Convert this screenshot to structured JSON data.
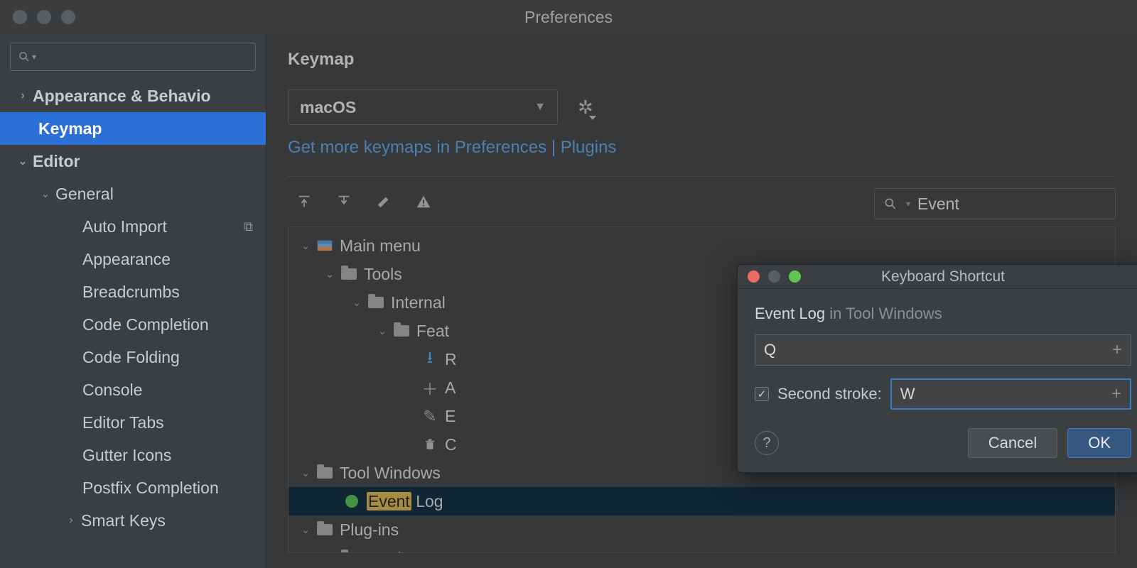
{
  "window": {
    "title": "Preferences"
  },
  "sidebar": {
    "items": [
      {
        "label": "Appearance & Behavio",
        "lvl": 0,
        "disc": "›"
      },
      {
        "label": "Keymap",
        "lvl": 1,
        "selected": true
      },
      {
        "label": "Editor",
        "lvl": 0,
        "disc": "⌄"
      },
      {
        "label": "General",
        "lvl": 1,
        "disc": "⌄"
      },
      {
        "label": "Auto Import",
        "lvl": 2,
        "trail_icon": true
      },
      {
        "label": "Appearance",
        "lvl": 2
      },
      {
        "label": "Breadcrumbs",
        "lvl": 2
      },
      {
        "label": "Code Completion",
        "lvl": 2
      },
      {
        "label": "Code Folding",
        "lvl": 2
      },
      {
        "label": "Console",
        "lvl": 2
      },
      {
        "label": "Editor Tabs",
        "lvl": 2
      },
      {
        "label": "Gutter Icons",
        "lvl": 2
      },
      {
        "label": "Postfix Completion",
        "lvl": 2
      },
      {
        "label": "Smart Keys",
        "lvl": 2,
        "disc": "›",
        "lvl2b": true
      }
    ]
  },
  "content": {
    "heading": "Keymap",
    "scheme": "macOS",
    "link": "Get more keymaps in Preferences | Plugins",
    "search_value": "Event",
    "tree": {
      "main_menu": "Main menu",
      "tools": "Tools",
      "internal": "Internal",
      "feat": "Feat",
      "r": "R",
      "a": "A",
      "e": "E",
      "c": "C",
      "tool_windows": "Tool Windows",
      "event": "Event",
      "log": " Log",
      "plugins": "Plug-ins",
      "spy": "Spy-is"
    }
  },
  "modal": {
    "title": "Keyboard Shortcut",
    "action": "Event Log",
    "context_label": " in Tool Windows",
    "first_stroke": "Q",
    "second_label": "Second stroke:",
    "second_stroke": "W",
    "cancel": "Cancel",
    "ok": "OK"
  }
}
